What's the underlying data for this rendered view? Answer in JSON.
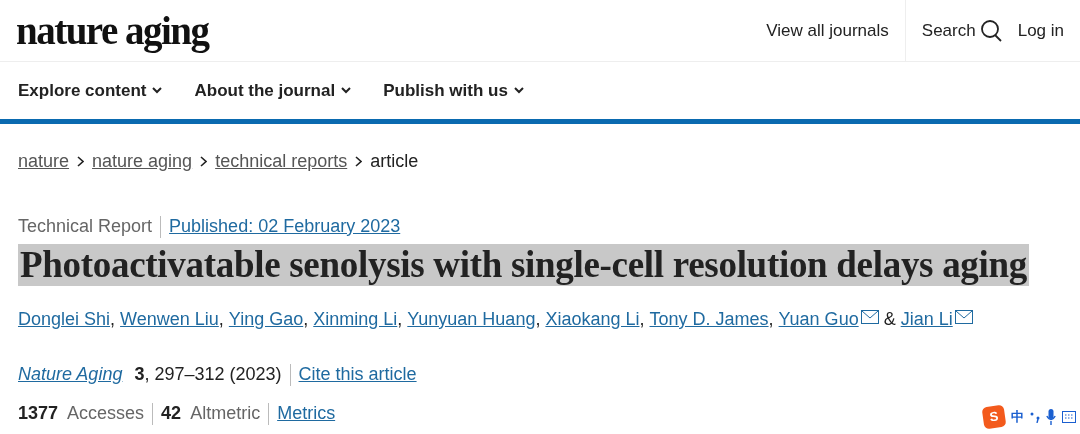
{
  "header": {
    "logo": "nature aging",
    "links": [
      {
        "label": "View all journals",
        "kind": "text"
      },
      {
        "label": "Search",
        "kind": "search"
      },
      {
        "label": "Log in",
        "kind": "text"
      }
    ]
  },
  "nav": [
    {
      "label": "Explore content"
    },
    {
      "label": "About the journal"
    },
    {
      "label": "Publish with us"
    }
  ],
  "breadcrumbs": [
    {
      "label": "nature",
      "current": false
    },
    {
      "label": "nature aging",
      "current": false
    },
    {
      "label": "technical reports",
      "current": false
    },
    {
      "label": "article",
      "current": true
    }
  ],
  "article": {
    "type": "Technical Report",
    "published": "Published: 02 February 2023",
    "title": "Photoactivatable senolysis with single-cell resolution delays aging",
    "authors": [
      {
        "name": "Donglei Shi",
        "corresponding": false,
        "after": ","
      },
      {
        "name": "Wenwen Liu",
        "corresponding": false,
        "after": ","
      },
      {
        "name": "Ying Gao",
        "corresponding": false,
        "after": ","
      },
      {
        "name": "Xinming Li",
        "corresponding": false,
        "after": ","
      },
      {
        "name": "Yunyuan Huang",
        "corresponding": false,
        "after": ","
      },
      {
        "name": "Xiaokang Li",
        "corresponding": false,
        "after": ","
      },
      {
        "name": "Tony D. James",
        "corresponding": false,
        "after": ","
      },
      {
        "name": "Yuan Guo",
        "corresponding": true,
        "after": "&"
      },
      {
        "name": "Jian Li",
        "corresponding": true
      }
    ],
    "citation": {
      "journal": "Nature Aging",
      "volume": "3",
      "pages": ", 297–312 (2023)",
      "cite": "Cite this article"
    },
    "metrics": [
      {
        "text": "**1377**  Accesses"
      },
      {
        "text": "**42**  Altmetric"
      }
    ],
    "metrics_link": "Metrics"
  },
  "ime": {
    "logo": "S",
    "mode": "中"
  }
}
